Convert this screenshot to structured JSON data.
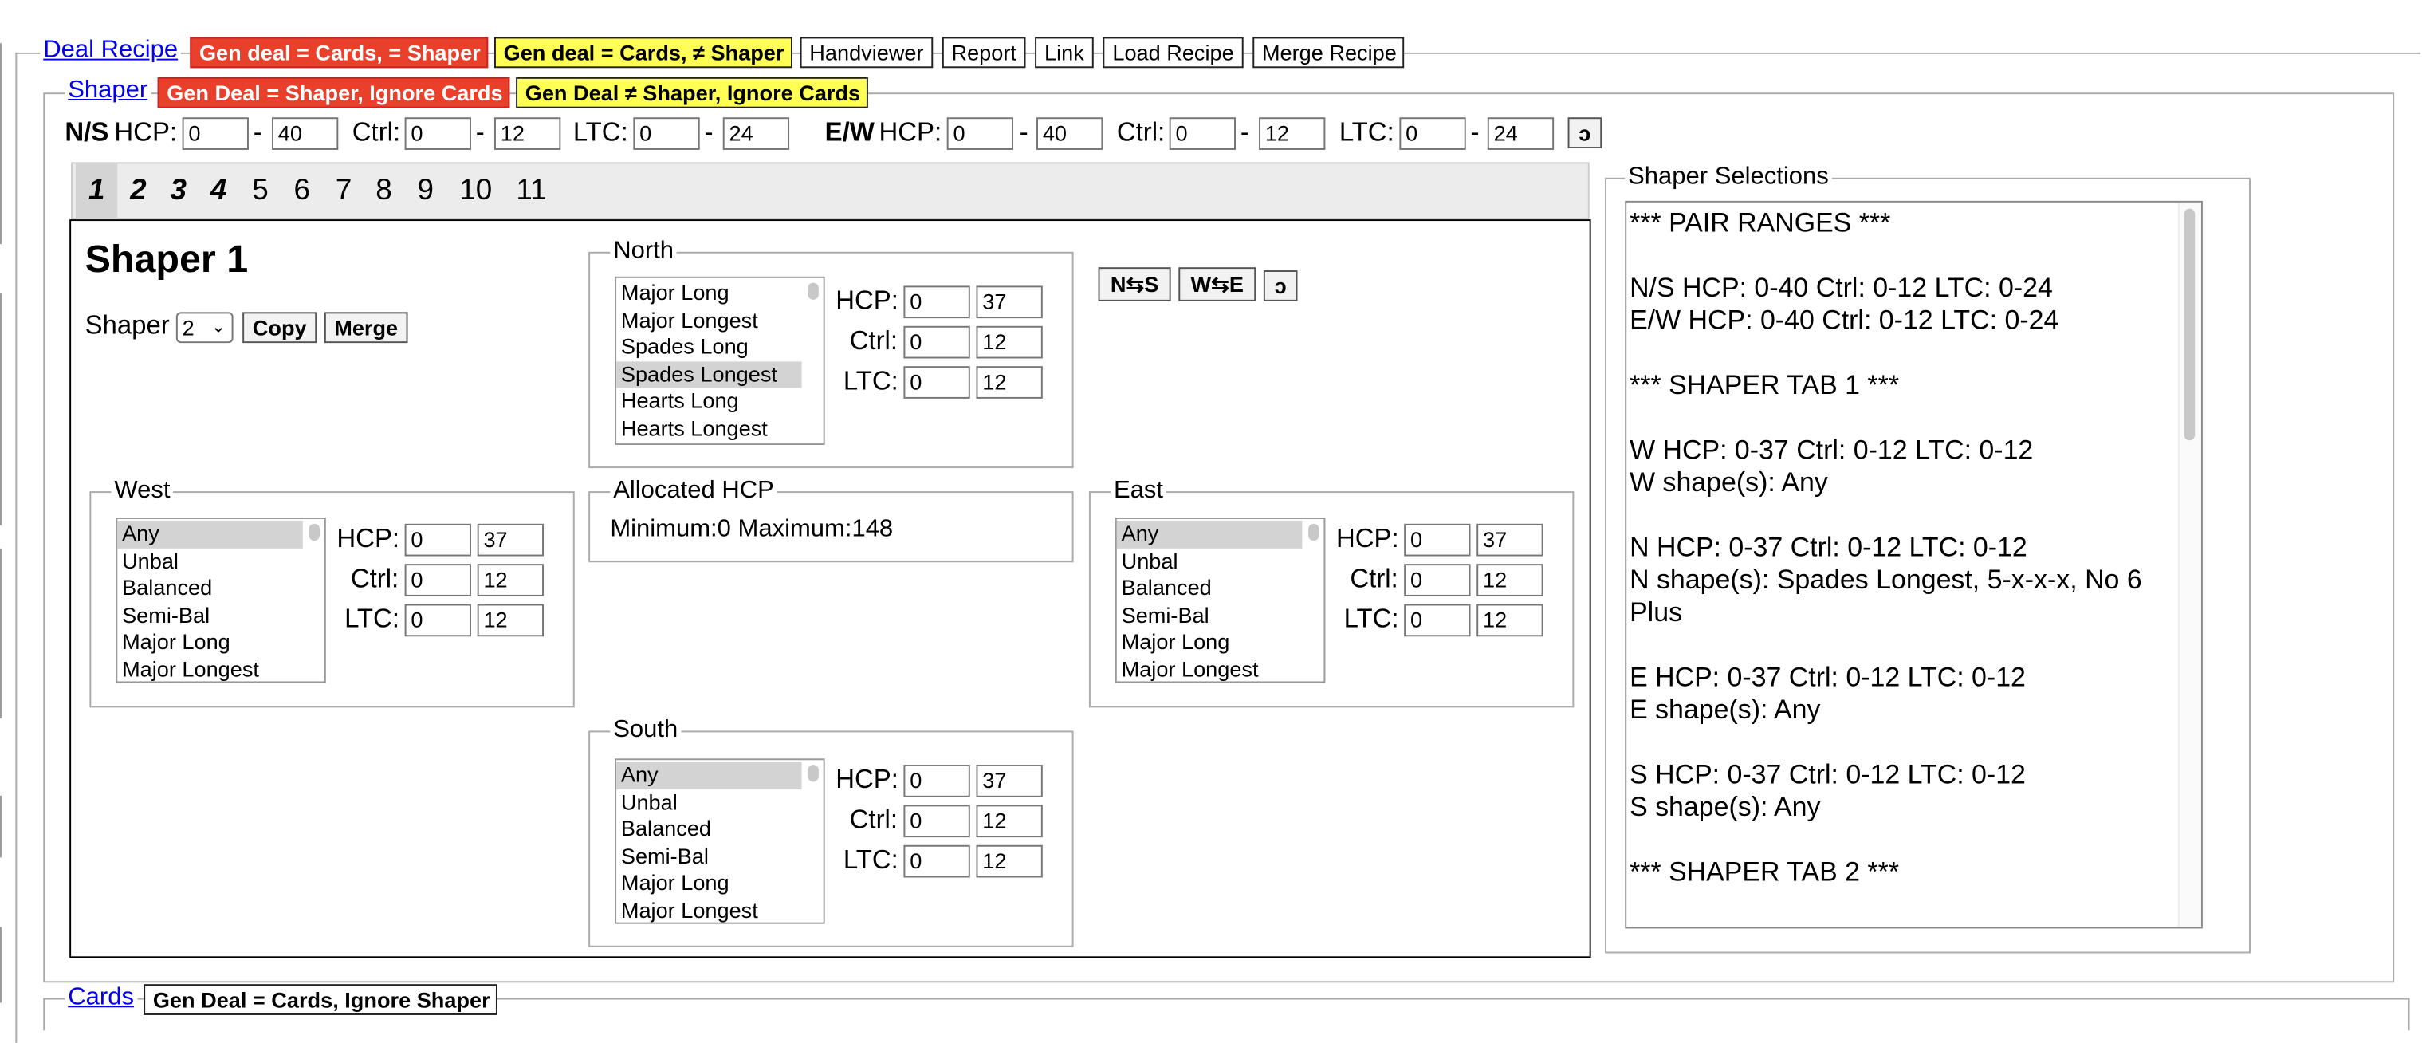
{
  "deal_recipe": {
    "title": "Deal Recipe",
    "buttons": [
      "Gen deal = Cards, = Shaper",
      "Gen deal = Cards, ≠ Shaper",
      "Handviewer",
      "Report",
      "Link",
      "Load Recipe",
      "Merge Recipe"
    ]
  },
  "shaper": {
    "title": "Shaper",
    "buttons": [
      "Gen Deal = Shaper, Ignore Cards",
      "Gen Deal ≠ Shaper, Ignore Cards"
    ],
    "ranges": {
      "ns_label": "N/S",
      "ew_label": "E/W",
      "hcp_label": "HCP:",
      "ctrl_label": "Ctrl:",
      "ltc_label": "LTC:",
      "dash": "-",
      "ns": {
        "hcp_min": "0",
        "hcp_max": "40",
        "ctrl_min": "0",
        "ctrl_max": "12",
        "ltc_min": "0",
        "ltc_max": "24"
      },
      "ew": {
        "hcp_min": "0",
        "hcp_max": "40",
        "ctrl_min": "0",
        "ctrl_max": "12",
        "ltc_min": "0",
        "ltc_max": "24"
      },
      "reset_icon": "ↄ"
    },
    "tabs": [
      "1",
      "2",
      "3",
      "4",
      "5",
      "6",
      "7",
      "8",
      "9",
      "10",
      "11"
    ],
    "active_tab": "1",
    "panel": {
      "title": "Shaper 1",
      "shaper_label": "Shaper",
      "shaper_select": "2",
      "copy_label": "Copy",
      "merge_label": "Merge",
      "swap_ns_label": "N⇆S",
      "swap_we_label": "W⇆E",
      "reset_icon": "ↄ",
      "allocated": {
        "title": "Allocated HCP",
        "text": "Minimum:0 Maximum:148"
      },
      "hands": {
        "north": {
          "title": "North",
          "options": [
            "Major Long",
            "Major Longest",
            "Spades Long",
            "Spades Longest",
            "Hearts Long",
            "Hearts Longest"
          ],
          "selected": "Spades Longest",
          "hcp_min": "0",
          "hcp_max": "37",
          "ctrl_min": "0",
          "ctrl_max": "12",
          "ltc_min": "0",
          "ltc_max": "12"
        },
        "west": {
          "title": "West",
          "options": [
            "Any",
            "Unbal",
            "Balanced",
            "Semi-Bal",
            "Major Long",
            "Major Longest"
          ],
          "selected": "Any",
          "hcp_min": "0",
          "hcp_max": "37",
          "ctrl_min": "0",
          "ctrl_max": "12",
          "ltc_min": "0",
          "ltc_max": "12"
        },
        "east": {
          "title": "East",
          "options": [
            "Any",
            "Unbal",
            "Balanced",
            "Semi-Bal",
            "Major Long",
            "Major Longest"
          ],
          "selected": "Any",
          "hcp_min": "0",
          "hcp_max": "37",
          "ctrl_min": "0",
          "ctrl_max": "12",
          "ltc_min": "0",
          "ltc_max": "12"
        },
        "south": {
          "title": "South",
          "options": [
            "Any",
            "Unbal",
            "Balanced",
            "Semi-Bal",
            "Major Long",
            "Major Longest"
          ],
          "selected": "Any",
          "hcp_min": "0",
          "hcp_max": "37",
          "ctrl_min": "0",
          "ctrl_max": "12",
          "ltc_min": "0",
          "ltc_max": "12"
        }
      }
    },
    "selections": {
      "title": "Shaper Selections",
      "lines": [
        "*** PAIR RANGES ***",
        "",
        "N/S HCP: 0-40  Ctrl: 0-12  LTC: 0-24",
        "E/W HCP: 0-40  Ctrl: 0-12  LTC: 0-24",
        "",
        "*** SHAPER TAB 1 ***",
        "",
        "W HCP: 0-37  Ctrl: 0-12  LTC: 0-12",
        "W shape(s): Any",
        "",
        "N HCP: 0-37  Ctrl: 0-12  LTC: 0-12",
        "N shape(s): Spades Longest, 5-x-x-x, No 6",
        "Plus",
        "",
        "E HCP: 0-37  Ctrl: 0-12  LTC: 0-12",
        "E shape(s): Any",
        "",
        "S HCP: 0-37  Ctrl: 0-12  LTC: 0-12",
        "S shape(s): Any",
        "",
        "*** SHAPER TAB 2 ***"
      ]
    }
  },
  "cards": {
    "title": "Cards",
    "button": "Gen Deal = Cards, Ignore Shaper"
  }
}
